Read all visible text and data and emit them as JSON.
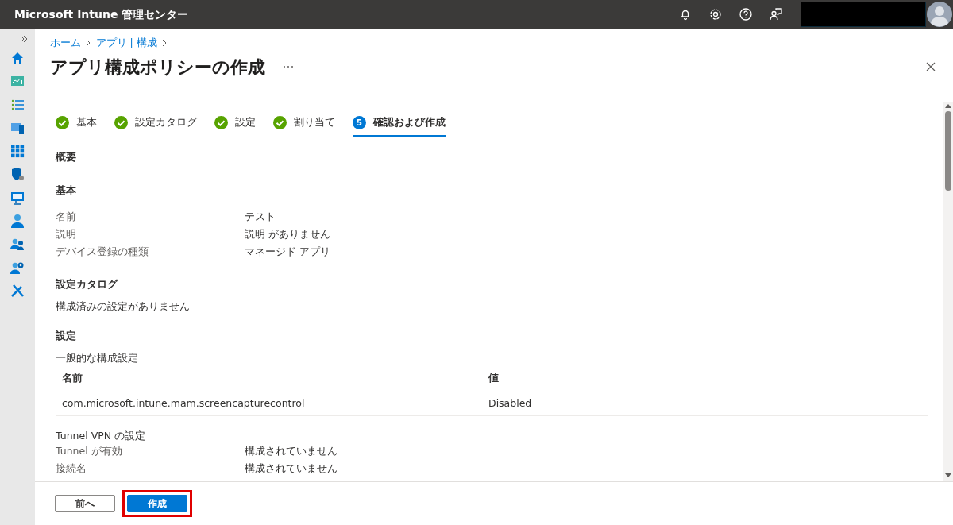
{
  "header": {
    "title": "Microsoft Intune 管理センター"
  },
  "breadcrumb": [
    "ホーム",
    "アプリ | 構成"
  ],
  "page": {
    "title": "アプリ構成ポリシーの作成"
  },
  "steps": [
    {
      "label": "基本",
      "kind": "done",
      "selected": false
    },
    {
      "label": "設定カタログ",
      "kind": "done",
      "selected": false
    },
    {
      "label": "設定",
      "kind": "done",
      "selected": false
    },
    {
      "label": "割り当て",
      "kind": "done",
      "selected": false
    },
    {
      "label": "確認および作成",
      "kind": "current",
      "number": "5",
      "selected": true
    }
  ],
  "summary_heading": "概要",
  "sections": [
    {
      "kind": "properties",
      "heading": "基本",
      "rows": [
        {
          "label": "名前",
          "value": "テスト"
        },
        {
          "label": "説明",
          "value": "説明 がありません"
        },
        {
          "label": "デバイス登録の種類",
          "value": "マネージド アプリ"
        }
      ]
    },
    {
      "kind": "note",
      "heading": "設定カタログ",
      "text": "構成済みの設定がありません"
    },
    {
      "kind": "table",
      "heading": "設定",
      "subheading": "一般的な構成設定",
      "columns": [
        "名前",
        "値"
      ],
      "rows": [
        [
          "com.microsoft.intune.mam.screencapturecontrol",
          "Disabled"
        ]
      ]
    },
    {
      "kind": "properties",
      "subheading": "Tunnel VPN の設定",
      "rows": [
        {
          "label": "Tunnel が有効",
          "value": "構成されていません"
        },
        {
          "label": "接続名",
          "value": "構成されていません"
        }
      ]
    }
  ],
  "footer": {
    "buttons": [
      {
        "label": "前へ",
        "kind": "secondary",
        "highlighted": false
      },
      {
        "label": "作成",
        "kind": "primary",
        "highlighted": true
      }
    ]
  }
}
